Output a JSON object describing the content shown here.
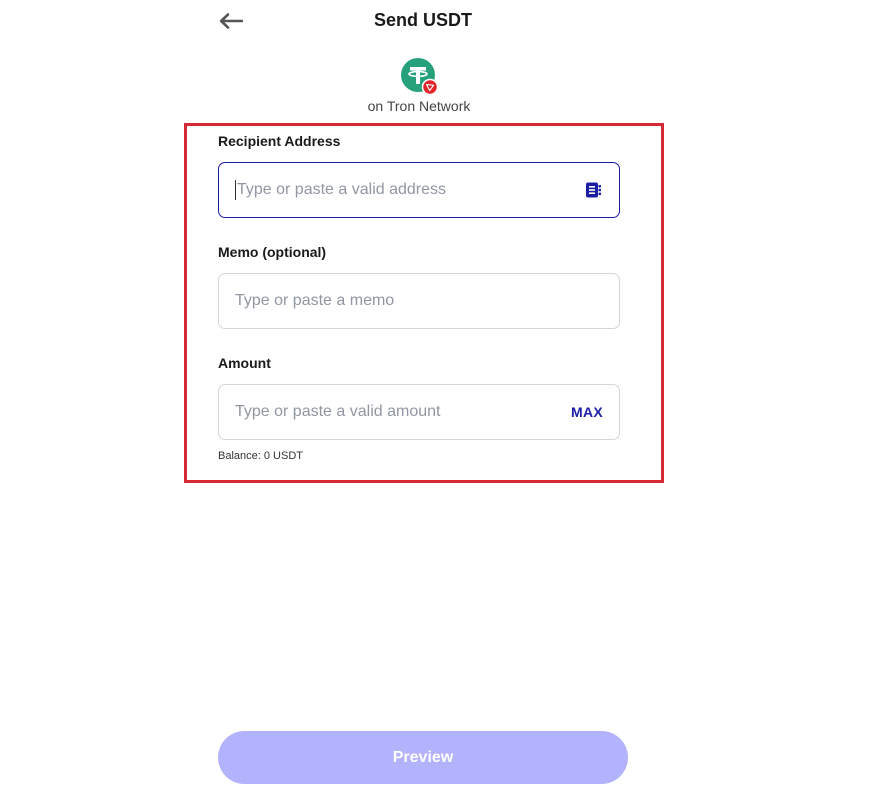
{
  "header": {
    "title": "Send USDT"
  },
  "token": {
    "network_label": "on Tron Network",
    "logo_color": "#26a17b",
    "badge_color": "#e0262b"
  },
  "form": {
    "recipient": {
      "label": "Recipient Address",
      "placeholder": "Type or paste a valid address",
      "value": ""
    },
    "memo": {
      "label": "Memo (optional)",
      "placeholder": "Type or paste a memo",
      "value": ""
    },
    "amount": {
      "label": "Amount",
      "placeholder": "Type or paste a valid amount",
      "value": "",
      "max_label": "MAX"
    },
    "balance": {
      "label": "Balance:",
      "value": "0 USDT"
    }
  },
  "actions": {
    "preview_label": "Preview"
  },
  "colors": {
    "accent": "#1b1ea5",
    "highlight": "#d52a35",
    "preview_button": "#b3b2fc"
  }
}
